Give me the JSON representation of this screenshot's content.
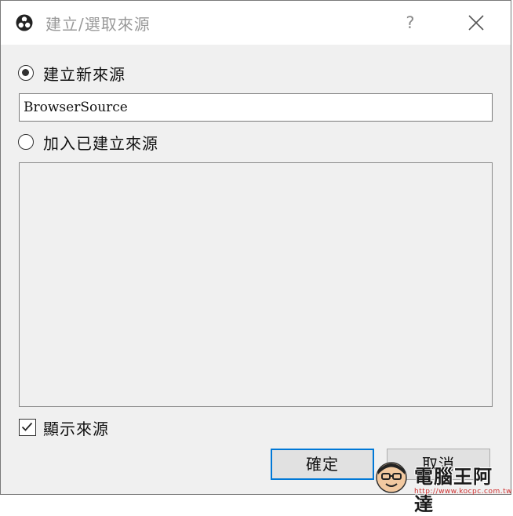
{
  "window": {
    "title": "建立/選取來源",
    "help_label": "?"
  },
  "create_new": {
    "label": "建立新來源",
    "checked": true,
    "name_value": "BrowserSource"
  },
  "add_existing": {
    "label": "加入已建立來源",
    "checked": false,
    "items": []
  },
  "show_source": {
    "label": "顯示來源",
    "checked": true
  },
  "buttons": {
    "ok_label": "確定",
    "cancel_label": "取消"
  },
  "watermark": {
    "brand": "電腦王阿達",
    "url": "http://www.kocpc.com.tw"
  },
  "colors": {
    "accent": "#0078d7",
    "dialog_bg": "#f0f0f0",
    "watermark_red": "#d03030"
  }
}
